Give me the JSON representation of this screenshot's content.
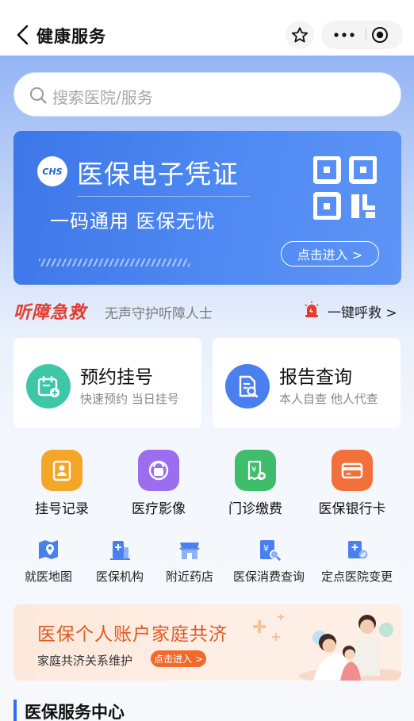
{
  "header": {
    "title": "健康服务"
  },
  "search": {
    "placeholder": "搜索医院/服务"
  },
  "banner": {
    "logo_text": "CHS",
    "title": "医保电子凭证",
    "subtitle": "一码通用 医保无忧",
    "button": "点击进入 >"
  },
  "hearing": {
    "title": "听障急救",
    "desc": "无声守护听障人士",
    "sos": "一键呼救 >"
  },
  "cards": [
    {
      "title": "预约挂号",
      "sub": "快速预约 当日挂号",
      "icon": "calendar-add-icon",
      "color": "#3ec6a8"
    },
    {
      "title": "报告查询",
      "sub": "本人自查 他人代查",
      "icon": "report-search-icon",
      "color": "#4a7ff0"
    }
  ],
  "big_grid": [
    {
      "label": "挂号记录",
      "icon": "record-icon",
      "color": "#f4a629"
    },
    {
      "label": "医疗影像",
      "icon": "imaging-icon",
      "color": "#9b6ef0"
    },
    {
      "label": "门诊缴费",
      "icon": "payment-icon",
      "color": "#3fbd6b"
    },
    {
      "label": "医保银行卡",
      "icon": "bank-card-icon",
      "color": "#f2713a"
    }
  ],
  "small_grid": [
    {
      "label": "就医地图",
      "icon": "map-icon"
    },
    {
      "label": "医保机构",
      "icon": "institution-icon"
    },
    {
      "label": "附近药店",
      "icon": "pharmacy-icon"
    },
    {
      "label": "医保消费查询",
      "icon": "consumption-query-icon"
    },
    {
      "label": "定点医院变更",
      "icon": "hospital-change-icon"
    }
  ],
  "promo": {
    "title": "医保个人账户家庭共济",
    "sub": "家庭共济关系维护",
    "button": "点击进入 >"
  },
  "section": {
    "title": "医保服务中心"
  },
  "colors": {
    "primary": "#2f6ef0",
    "hearing": "#e43b2c",
    "promo": "#e05a20"
  }
}
